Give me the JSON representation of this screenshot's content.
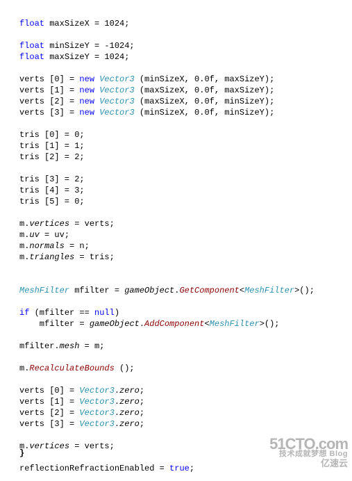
{
  "code": {
    "l00": "float",
    "l00b": " maxSizeX = 1024;",
    "blank": "",
    "l01": "float",
    "l01b": " minSizeY = -1024;",
    "l02": "float",
    "l02b": " maxSizeY = 1024;",
    "l03a": "verts [0] = ",
    "l03n": "new",
    "l03v": " Vector3",
    "l03c": " (minSizeX, 0.0f, maxSizeY);",
    "l04a": "verts [1] = ",
    "l04v": " Vector3",
    "l04c": " (maxSizeX, 0.0f, maxSizeY);",
    "l05a": "verts [2] = ",
    "l05v": " Vector3",
    "l05c": " (maxSizeX, 0.0f, minSizeY);",
    "l06a": "verts [3] = ",
    "l06v": " Vector3",
    "l06c": " (minSizeX, 0.0f, minSizeY);",
    "l07": "tris [0] = 0;",
    "l08": "tris [1] = 1;",
    "l09": "tris [2] = 2;",
    "l10": "tris [3] = 2;",
    "l11": "tris [4] = 3;",
    "l12": "tris [5] = 0;",
    "l13a": "m.",
    "l13i": "vertices",
    "l13b": " = verts;",
    "l14a": "m.",
    "l14i": "uv",
    "l14b": " = uv;",
    "l15a": "m.",
    "l15i": "normals",
    "l15b": " = n;",
    "l16a": "m.",
    "l16i": "triangles",
    "l16b": " = tris;",
    "l17t": "MeshFilter",
    "l17a": " mfilter = ",
    "l17g": "gameObject",
    "l17d": ".",
    "l17m": "GetComponent",
    "l17b": "<",
    "l17mf": "MeshFilter",
    "l17e": ">();",
    "l18k": "if",
    "l18a": " (mfilter == ",
    "l18n": "null",
    "l18b": ")",
    "l19a": "    mfilter = ",
    "l19g": "gameObject",
    "l19d": ".",
    "l19m": "AddComponent",
    "l19b": "<",
    "l19mf": "MeshFilter",
    "l19e": ">();",
    "l20a": "mfilter.",
    "l20i": "mesh",
    "l20b": " = m;",
    "l21a": "m.",
    "l21m": "RecalculateBounds",
    "l21b": " ();",
    "l22a": "verts [0] = ",
    "l22v": "Vector3",
    "l22d": ".",
    "l22z": "zero",
    "l22e": ";",
    "l23a": "verts [1] = ",
    "l24a": "verts [2] = ",
    "l25a": "verts [3] = ",
    "l26a": "m.",
    "l26i": "vertices",
    "l26b": " = verts;",
    "l27a": "reflectionRefractionEnabled = ",
    "l27t": "true",
    "l27e": ";",
    "brace": "}"
  },
  "watermark": {
    "line1": "51CTO.com",
    "line2": "技术成就梦想  Blog",
    "line3": "亿速云"
  }
}
